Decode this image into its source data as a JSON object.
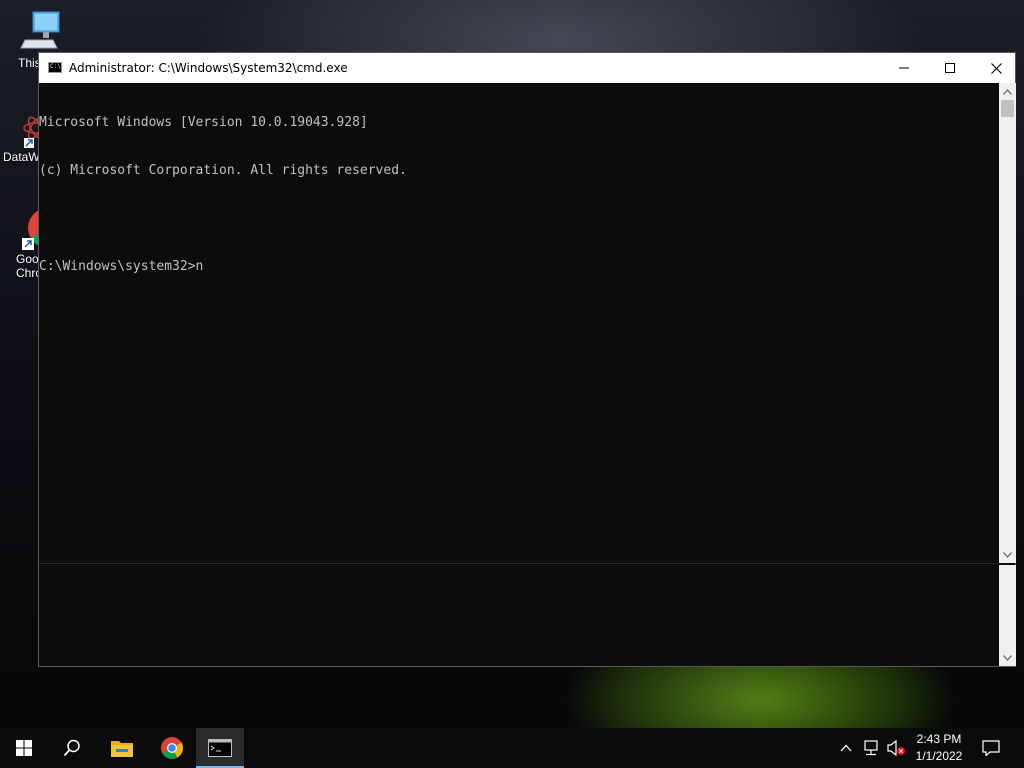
{
  "desktop": {
    "icons": [
      {
        "label": "This"
      },
      {
        "label": "DataW"
      },
      {
        "label": "Goo\nChro"
      }
    ]
  },
  "window": {
    "title": "Administrator: C:\\Windows\\System32\\cmd.exe",
    "console_lines": [
      "Microsoft Windows [Version 10.0.19043.928]",
      "(c) Microsoft Corporation. All rights reserved.",
      "",
      "C:\\Windows\\system32>n"
    ]
  },
  "taskbar": {
    "clock": {
      "time": "2:43 PM",
      "date": "1/1/2022"
    },
    "accent": "#76b9ed"
  },
  "colors": {
    "console_bg": "#0c0c0c",
    "console_fg": "#c0c0c0"
  }
}
